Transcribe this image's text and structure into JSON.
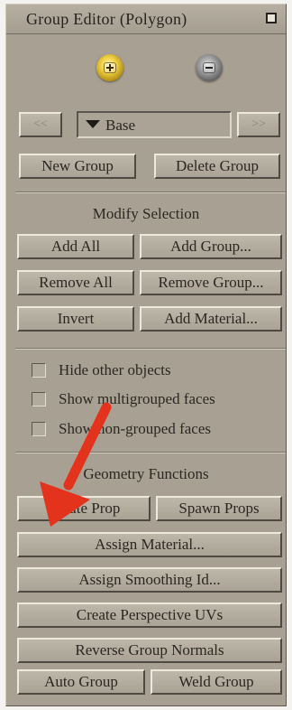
{
  "window": {
    "title": "Group Editor (Polygon)"
  },
  "icons": {
    "close": "close-box-icon",
    "add_group_round": "add-group-round-icon",
    "remove_group_round": "remove-group-round-icon",
    "dropdown_arrow": "triangle-down-icon",
    "annotation_arrow": "red-arrow-icon"
  },
  "colors": {
    "panel": "#a8a193",
    "annotation_arrow": "#e3331c",
    "add_round": "#f0d043",
    "remove_round": "#9a9a9a"
  },
  "nav": {
    "prev_label": "<<",
    "next_label": ">>"
  },
  "group_select": {
    "selected": "Base"
  },
  "group_buttons": {
    "new": "New Group",
    "delete": "Delete Group"
  },
  "modify_selection": {
    "heading": "Modify Selection",
    "add_all": "Add All",
    "add_group": "Add Group...",
    "remove_all": "Remove All",
    "remove_group": "Remove Group...",
    "invert": "Invert",
    "add_material": "Add Material..."
  },
  "options": [
    {
      "label": "Hide other objects",
      "checked": false
    },
    {
      "label": "Show multigrouped faces",
      "checked": false
    },
    {
      "label": "Show non-grouped faces",
      "checked": false
    }
  ],
  "geometry_functions": {
    "heading": "Geometry Functions",
    "create_prop": "Create Prop",
    "spawn_props": "Spawn Props",
    "assign_material": "Assign Material...",
    "assign_smoothing": "Assign Smoothing Id...",
    "create_uvs": "Create Perspective UVs",
    "reverse_normals": "Reverse Group Normals",
    "auto_group": "Auto Group",
    "weld_group": "Weld Group"
  }
}
